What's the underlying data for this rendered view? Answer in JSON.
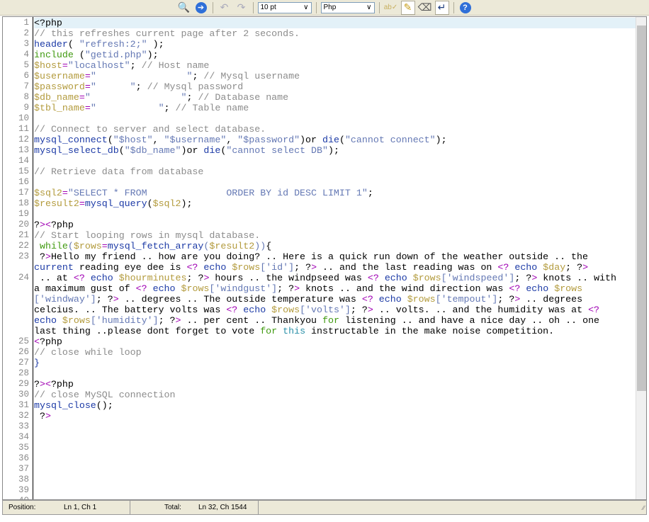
{
  "toolbar": {
    "font_size": "10 pt",
    "language": "Php",
    "icons": [
      "find-icon",
      "goto-icon",
      "undo-icon",
      "redo-icon",
      "spellcheck-icon",
      "highlight-icon",
      "eraser-icon",
      "wordwrap-icon",
      "help-icon"
    ]
  },
  "colors": {
    "keyword": "#1c3aa6",
    "string": "#6478b4",
    "variable": "#b39b3d",
    "comment": "#8c8c8c",
    "operator": "#a000b4",
    "control": "#409a10"
  },
  "code": [
    {
      "n": "1",
      "tk": [
        [
          "t",
          "<?php"
        ]
      ]
    },
    {
      "n": "2",
      "tk": [
        [
          "c",
          "// this refreshes current page after 2 seconds."
        ]
      ]
    },
    {
      "n": "3",
      "tk": [
        [
          "f",
          "header"
        ],
        [
          "t",
          "( "
        ],
        [
          "s",
          "\"refresh:2;\""
        ],
        [
          "t",
          " );"
        ]
      ]
    },
    {
      "n": "4",
      "tk": [
        [
          "g",
          "include"
        ],
        [
          "t",
          " ("
        ],
        [
          "s",
          "\"getid.php\""
        ],
        [
          "t",
          ");"
        ]
      ]
    },
    {
      "n": "5",
      "tk": [
        [
          "v",
          "$host"
        ],
        [
          "o",
          "="
        ],
        [
          "s",
          "\"localhost\""
        ],
        [
          "t",
          "; "
        ],
        [
          "c",
          "// Host name"
        ]
      ]
    },
    {
      "n": "6",
      "tk": [
        [
          "v",
          "$username"
        ],
        [
          "o",
          "="
        ],
        [
          "s",
          "\"                \""
        ],
        [
          "t",
          "; "
        ],
        [
          "c",
          "// Mysql username"
        ]
      ]
    },
    {
      "n": "7",
      "tk": [
        [
          "v",
          "$password"
        ],
        [
          "o",
          "="
        ],
        [
          "s",
          "\"      \""
        ],
        [
          "t",
          "; "
        ],
        [
          "c",
          "// Mysql password"
        ]
      ]
    },
    {
      "n": "8",
      "tk": [
        [
          "v",
          "$db_name"
        ],
        [
          "o",
          "="
        ],
        [
          "s",
          "\"                \""
        ],
        [
          "t",
          "; "
        ],
        [
          "c",
          "// Database name"
        ]
      ]
    },
    {
      "n": "9",
      "tk": [
        [
          "v",
          "$tbl_name"
        ],
        [
          "o",
          "="
        ],
        [
          "s",
          "\"           \""
        ],
        [
          "t",
          "; "
        ],
        [
          "c",
          "// Table name"
        ]
      ]
    },
    {
      "n": "10",
      "tk": []
    },
    {
      "n": "11",
      "tk": [
        [
          "c",
          "// Connect to server and select database."
        ]
      ]
    },
    {
      "n": "12",
      "tk": [
        [
          "f",
          "mysql_connect"
        ],
        [
          "t",
          "("
        ],
        [
          "s",
          "\"$host\""
        ],
        [
          "t",
          ", "
        ],
        [
          "s",
          "\"$username\""
        ],
        [
          "t",
          ", "
        ],
        [
          "s",
          "\"$password\""
        ],
        [
          "t",
          ")or "
        ],
        [
          "f",
          "die"
        ],
        [
          "t",
          "("
        ],
        [
          "s",
          "\"cannot connect\""
        ],
        [
          "t",
          ");"
        ]
      ]
    },
    {
      "n": "13",
      "tk": [
        [
          "f",
          "mysql_select_db"
        ],
        [
          "t",
          "("
        ],
        [
          "s",
          "\"$db_name\""
        ],
        [
          "t",
          ")or "
        ],
        [
          "f",
          "die"
        ],
        [
          "t",
          "("
        ],
        [
          "s",
          "\"cannot select DB\""
        ],
        [
          "t",
          ");"
        ]
      ]
    },
    {
      "n": "14",
      "tk": []
    },
    {
      "n": "15",
      "tk": [
        [
          "c",
          "// Retrieve data from database"
        ]
      ]
    },
    {
      "n": "16",
      "tk": []
    },
    {
      "n": "17",
      "tk": [
        [
          "v",
          "$sql2"
        ],
        [
          "o",
          "="
        ],
        [
          "s",
          "\"SELECT * FROM              ORDER BY id DESC LIMIT 1\""
        ],
        [
          "t",
          ";"
        ]
      ]
    },
    {
      "n": "18",
      "tk": [
        [
          "v",
          "$result2"
        ],
        [
          "o",
          "="
        ],
        [
          "f",
          "mysql_query"
        ],
        [
          "t",
          "("
        ],
        [
          "v",
          "$sql2"
        ],
        [
          "t",
          ");"
        ]
      ]
    },
    {
      "n": "19",
      "tk": []
    },
    {
      "n": "20",
      "tk": [
        [
          "t",
          "?"
        ],
        [
          "o",
          "><"
        ],
        [
          "t",
          "?php"
        ]
      ]
    },
    {
      "n": "21",
      "tk": [
        [
          "c",
          "// Start looping rows in mysql database."
        ]
      ]
    },
    {
      "n": "22",
      "tk": [
        [
          "t",
          " "
        ],
        [
          "g",
          "while"
        ],
        [
          "s",
          "("
        ],
        [
          "v",
          "$rows"
        ],
        [
          "o",
          "="
        ],
        [
          "f",
          "mysql_fetch_array"
        ],
        [
          "s",
          "("
        ],
        [
          "v",
          "$result2"
        ],
        [
          "s",
          "))"
        ],
        [
          "t",
          "{"
        ]
      ]
    },
    {
      "n": "23",
      "tk": [
        [
          "t",
          " ?"
        ],
        [
          "o",
          ">"
        ],
        [
          "t",
          "Hello my friend .. how are you doing? .. Here is a quick run down of the weather outside .. the"
        ]
      ]
    },
    {
      "n": "",
      "tk": [
        [
          "f",
          "current"
        ],
        [
          "t",
          " reading eye dee is "
        ],
        [
          "o",
          "<?"
        ],
        [
          "t",
          " "
        ],
        [
          "f",
          "echo"
        ],
        [
          "t",
          " "
        ],
        [
          "v",
          "$rows"
        ],
        [
          "s",
          "['id']"
        ],
        [
          "t",
          "; ?"
        ],
        [
          "o",
          ">"
        ],
        [
          "t",
          " .. and the last reading was on "
        ],
        [
          "o",
          "<?"
        ],
        [
          "t",
          " "
        ],
        [
          "f",
          "echo"
        ],
        [
          "t",
          " "
        ],
        [
          "v",
          "$day"
        ],
        [
          "t",
          "; ?"
        ],
        [
          "o",
          ">"
        ]
      ]
    },
    {
      "n": "24",
      "tk": [
        [
          "t",
          " .. at "
        ],
        [
          "o",
          "<?"
        ],
        [
          "t",
          " "
        ],
        [
          "f",
          "echo"
        ],
        [
          "t",
          " "
        ],
        [
          "v",
          "$hourminutes"
        ],
        [
          "t",
          "; ?"
        ],
        [
          "o",
          ">"
        ],
        [
          "t",
          " hours .. the windpseed was "
        ],
        [
          "o",
          "<?"
        ],
        [
          "t",
          " "
        ],
        [
          "f",
          "echo"
        ],
        [
          "t",
          " "
        ],
        [
          "v",
          "$rows"
        ],
        [
          "s",
          "['windspeed']"
        ],
        [
          "t",
          "; ?"
        ],
        [
          "o",
          ">"
        ],
        [
          "t",
          " knots .. with"
        ]
      ]
    },
    {
      "n": "",
      "tk": [
        [
          "t",
          "a maximum gust of "
        ],
        [
          "o",
          "<?"
        ],
        [
          "t",
          " "
        ],
        [
          "f",
          "echo"
        ],
        [
          "t",
          " "
        ],
        [
          "v",
          "$rows"
        ],
        [
          "s",
          "['windgust']"
        ],
        [
          "t",
          "; ?"
        ],
        [
          "o",
          ">"
        ],
        [
          "t",
          " knots .. and the wind direction was "
        ],
        [
          "o",
          "<?"
        ],
        [
          "t",
          " "
        ],
        [
          "f",
          "echo"
        ],
        [
          "t",
          " "
        ],
        [
          "v",
          "$rows"
        ]
      ]
    },
    {
      "n": "",
      "tk": [
        [
          "s",
          "['windway']"
        ],
        [
          "t",
          "; ?"
        ],
        [
          "o",
          ">"
        ],
        [
          "t",
          " .. degrees .. The outside temperature was "
        ],
        [
          "o",
          "<?"
        ],
        [
          "t",
          " "
        ],
        [
          "f",
          "echo"
        ],
        [
          "t",
          " "
        ],
        [
          "v",
          "$rows"
        ],
        [
          "s",
          "['tempout']"
        ],
        [
          "t",
          "; ?"
        ],
        [
          "o",
          ">"
        ],
        [
          "t",
          " .. degrees"
        ]
      ]
    },
    {
      "n": "",
      "tk": [
        [
          "t",
          "celcius. .. The battery volts was "
        ],
        [
          "o",
          "<?"
        ],
        [
          "t",
          " "
        ],
        [
          "f",
          "echo"
        ],
        [
          "t",
          " "
        ],
        [
          "v",
          "$rows"
        ],
        [
          "s",
          "['volts']"
        ],
        [
          "t",
          "; ?"
        ],
        [
          "o",
          ">"
        ],
        [
          "t",
          " .. volts. .. and the humidity was at "
        ],
        [
          "o",
          "<?"
        ]
      ]
    },
    {
      "n": "",
      "tk": [
        [
          "f",
          "echo"
        ],
        [
          "t",
          " "
        ],
        [
          "v",
          "$rows"
        ],
        [
          "s",
          "['humidity']"
        ],
        [
          "t",
          "; ?"
        ],
        [
          "o",
          ">"
        ],
        [
          "t",
          " .. per cent .. Thankyou "
        ],
        [
          "g",
          "for"
        ],
        [
          "t",
          " listening .. and have a nice day .. oh .. one"
        ]
      ]
    },
    {
      "n": "",
      "tk": [
        [
          "t",
          "last thing ..please dont forget to vote "
        ],
        [
          "g",
          "for"
        ],
        [
          "t",
          " "
        ],
        [
          "th",
          "this"
        ],
        [
          "t",
          " instructable in the make noise competition."
        ]
      ]
    },
    {
      "n": "25",
      "tk": [
        [
          "o",
          "<"
        ],
        [
          "t",
          "?php"
        ]
      ]
    },
    {
      "n": "26",
      "tk": [
        [
          "c",
          "// close while loop"
        ]
      ]
    },
    {
      "n": "27",
      "tk": [
        [
          "f",
          "}"
        ]
      ]
    },
    {
      "n": "28",
      "tk": []
    },
    {
      "n": "29",
      "tk": [
        [
          "t",
          "?"
        ],
        [
          "o",
          "><"
        ],
        [
          "t",
          "?php"
        ]
      ]
    },
    {
      "n": "30",
      "tk": [
        [
          "c",
          "// close MySQL connection"
        ]
      ]
    },
    {
      "n": "31",
      "tk": [
        [
          "f",
          "mysql_close"
        ],
        [
          "t",
          "();"
        ]
      ]
    },
    {
      "n": "32",
      "tk": [
        [
          "t",
          " ?"
        ],
        [
          "o",
          ">"
        ]
      ]
    },
    {
      "n": "33",
      "tk": []
    },
    {
      "n": "34",
      "tk": []
    },
    {
      "n": "35",
      "tk": []
    },
    {
      "n": "36",
      "tk": []
    },
    {
      "n": "37",
      "tk": []
    },
    {
      "n": "38",
      "tk": []
    },
    {
      "n": "39",
      "tk": []
    },
    {
      "n": "40",
      "tk": []
    }
  ],
  "status": {
    "position_label": "Position:",
    "position_value": "Ln 1, Ch 1",
    "total_label": "Total:",
    "total_value": "Ln 32, Ch 1544"
  }
}
